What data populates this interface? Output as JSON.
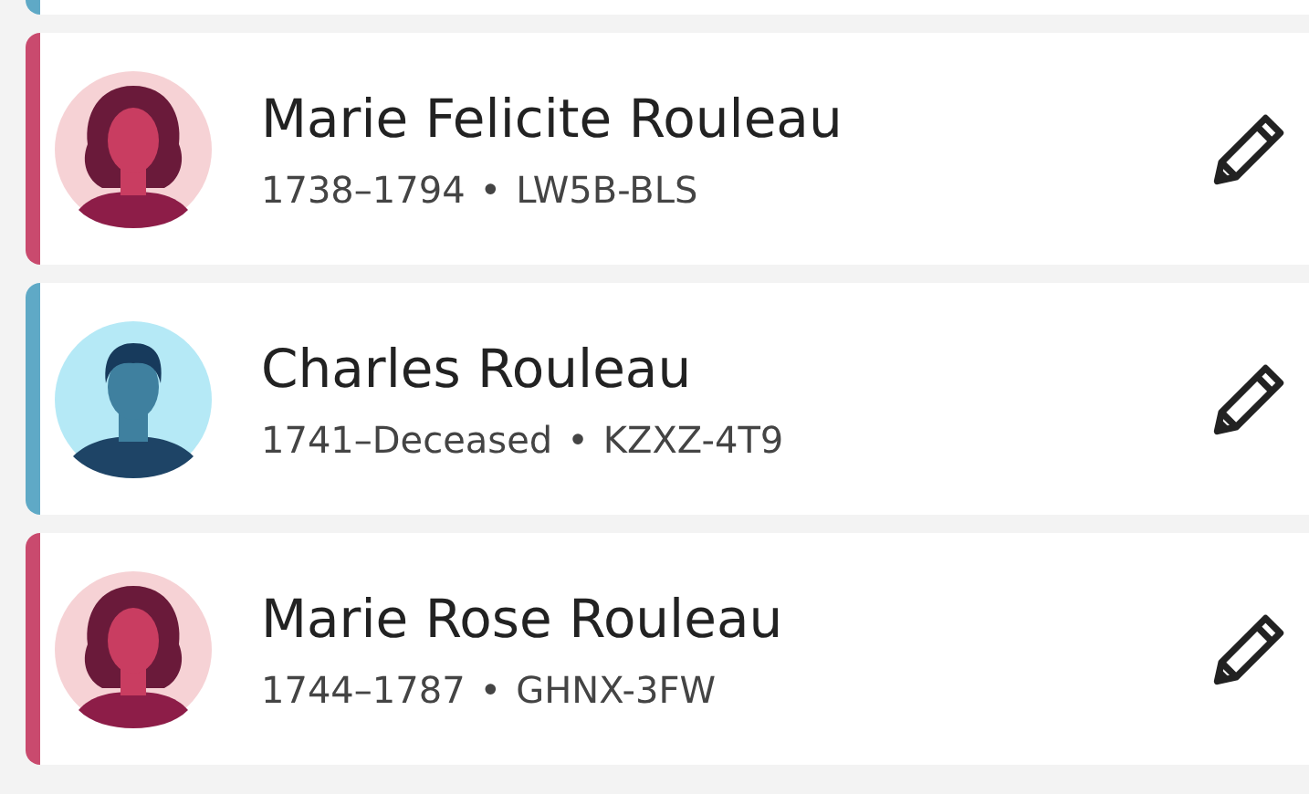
{
  "previous_card": {
    "kind": "male"
  },
  "people": [
    {
      "name": "Marie Felicite Rouleau",
      "lifespan": "1738–1794",
      "separator": "•",
      "id": "LW5B-BLS",
      "kind": "female"
    },
    {
      "name": "Charles Rouleau",
      "lifespan": "1741–Deceased",
      "separator": "•",
      "id": "KZXZ-4T9",
      "kind": "male"
    },
    {
      "name": "Marie Rose Rouleau",
      "lifespan": "1744–1787",
      "separator": "•",
      "id": "GHNX-3FW",
      "kind": "female"
    }
  ]
}
